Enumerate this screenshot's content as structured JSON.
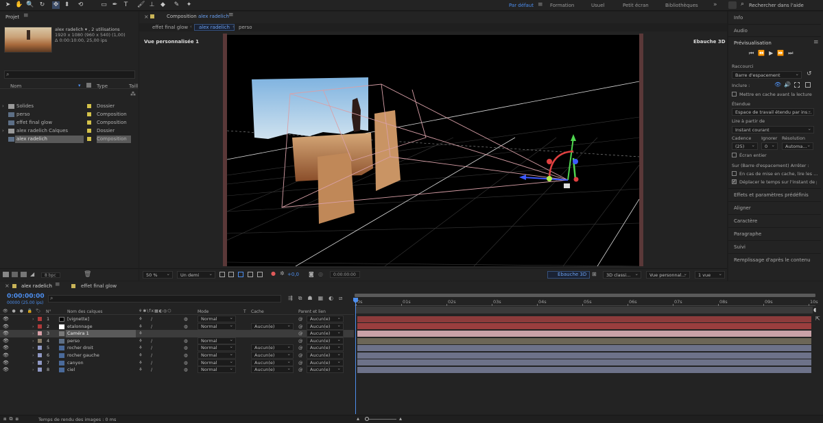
{
  "toolbar": {
    "icons": [
      "arrow-icon",
      "hand-icon",
      "zoom-icon",
      "orbit-icon",
      "move-icon",
      "pan-icon",
      "rotate-icon",
      "rect-mask-icon",
      "pen-icon",
      "text-icon",
      "brush-icon",
      "stamp-icon",
      "eraser-icon",
      "roto-icon",
      "puppet-icon"
    ],
    "workspaces": [
      {
        "label": "Par défaut",
        "active": true
      },
      {
        "label": "Formation"
      },
      {
        "label": "Usuel"
      },
      {
        "label": "Petit écran"
      },
      {
        "label": "Bibliothèques"
      }
    ],
    "search_placeholder": "Rechercher dans l'aide"
  },
  "project": {
    "title": "Projet",
    "item_name": "alex radelich ▾ , 2 utilisations",
    "item_dims": "1920 x 1080  (960 x 540) (1,00)",
    "item_duration": "Δ 0:00:10:00, 25,00 ips",
    "columns": {
      "name": "Nom",
      "type": "Type",
      "size": "Taill"
    },
    "items": [
      {
        "name": "Solides",
        "type": "Dossier",
        "color": "#d4c24a",
        "kind": "folder"
      },
      {
        "name": "perso",
        "type": "Composition",
        "color": "#d4c24a",
        "kind": "comp"
      },
      {
        "name": "effet final glow",
        "type": "Composition",
        "color": "#d4c24a",
        "kind": "comp"
      },
      {
        "name": "alex radelich Calques",
        "type": "Dossier",
        "color": "#d4c24a",
        "kind": "folder"
      },
      {
        "name": "alex radelich",
        "type": "Composition",
        "color": "#d4c24a",
        "kind": "comp",
        "selected": true
      }
    ],
    "bpc": "8 bpc"
  },
  "composition": {
    "panel_label": "Composition",
    "comp_name": "alex radelich",
    "breadcrumbs": [
      "effet final glow",
      "alex radelich",
      "perso"
    ],
    "view_label": "Vue personnalisée 1",
    "renderer_label": "Ebauche 3D"
  },
  "viewer_bar": {
    "zoom": "50 %",
    "resolution": "Un demi",
    "exposure": "+0,0",
    "timecode": "0:00:00:00",
    "draft": "Ebauche 3D",
    "renderer": "3D classi...",
    "view": "Vue personnal...",
    "views": "1 vue"
  },
  "right": {
    "info": "Info",
    "audio": "Audio",
    "preview": "Prévisualisation",
    "shortcut_label": "Raccourci",
    "shortcut": "Barre d'espacement",
    "include_label": "Inclure :",
    "cache_before": "Mettre en cache avant la lecture",
    "range_label": "Étendue",
    "range": "Espace de travail étendu par ins...",
    "play_from_label": "Lire à partir de",
    "play_from": "Instant courant",
    "framerate_label": "Cadence",
    "skip_label": "Ignorer",
    "res_label": "Résolution",
    "framerate": "(25)",
    "skip": "0",
    "res": "Automa...",
    "fullscreen": "Écran entier",
    "stop_label": "Sur (Barre d'espacement) Arrêter :",
    "cache_opt": "En cas de mise en cache, lire les ...",
    "move_time": "Déplacer le temps sur l'instant de pr",
    "panels": [
      "Effets et paramètres prédéfinis",
      "Aligner",
      "Caractère",
      "Paragraphe",
      "Suivi",
      "Remplissage d'après le contenu"
    ]
  },
  "timeline": {
    "tabs": [
      {
        "label": "alex radelich",
        "active": true
      },
      {
        "label": "effet final glow"
      }
    ],
    "timecode": "0:00:00:00",
    "frames": "00000 (25.00 ips)",
    "columns": {
      "num": "N°",
      "name": "Nom des calques",
      "mode": "Mode",
      "t": "T",
      "cache": "Cache",
      "parent": "Parent et lien"
    },
    "ticks": [
      "0s",
      "01s",
      "02s",
      "03s",
      "04s",
      "05s",
      "06s",
      "07s",
      "08s",
      "09s",
      "10s"
    ],
    "layers": [
      {
        "num": "1",
        "name": "[vignette]",
        "label": "#b03a3a",
        "mode": "Normal",
        "cache": "",
        "parent": "Aucun(e)",
        "bar": "#8c3b3b",
        "icon": "solid-black"
      },
      {
        "num": "2",
        "name": "etalonnage",
        "label": "#b03a3a",
        "mode": "Normal",
        "cache": "Aucun(e)",
        "parent": "Aucun(e)",
        "bar": "#9a3e3e",
        "icon": "solid-white"
      },
      {
        "num": "3",
        "name": "Caméra 1",
        "label": "#d9a0a8",
        "mode": "",
        "cache": "",
        "parent": "Aucun(e)",
        "bar": "#c9a1a7",
        "icon": "camera",
        "selected": true
      },
      {
        "num": "4",
        "name": "perso",
        "label": "#8a7e68",
        "mode": "Normal",
        "cache": "",
        "parent": "Aucun(e)",
        "bar": "#6c6657",
        "icon": "comp"
      },
      {
        "num": "5",
        "name": "rocher droit",
        "label": "#8f98c4",
        "mode": "Normal",
        "cache": "Aucun(e)",
        "parent": "Aucun(e)",
        "bar": "#6d7289",
        "icon": "footage"
      },
      {
        "num": "6",
        "name": "rocher gauche",
        "label": "#8f98c4",
        "mode": "Normal",
        "cache": "Aucun(e)",
        "parent": "Aucun(e)",
        "bar": "#6d7289",
        "icon": "footage"
      },
      {
        "num": "7",
        "name": "canyon",
        "label": "#8f98c4",
        "mode": "Normal",
        "cache": "Aucun(e)",
        "parent": "Aucun(e)",
        "bar": "#6d7289",
        "icon": "footage"
      },
      {
        "num": "8",
        "name": "ciel",
        "label": "#8f98c4",
        "mode": "Normal",
        "cache": "Aucun(e)",
        "parent": "Aucun(e)",
        "bar": "#6d7289",
        "icon": "footage"
      }
    ],
    "render_time": "Temps de rendu des images : 0 ms"
  }
}
